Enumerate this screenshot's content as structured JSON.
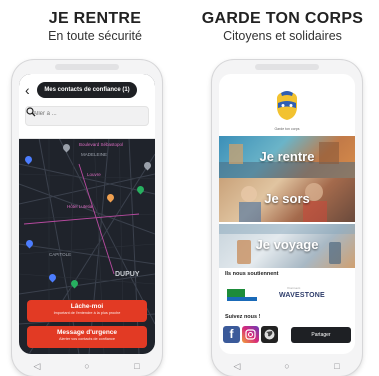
{
  "left_panel": {
    "title": "JE RENTRE",
    "subtitle": "En toute sécurité",
    "header": {
      "contacts_label": "Mes contacts de confiance (1)",
      "search_placeholder": "Aller à ..."
    },
    "map_labels": {
      "a": "Boulevard Sébastopol",
      "b": "MADELEINE",
      "c": "Louvre",
      "d": "Hôtel Lutetia",
      "e": "DUPUY",
      "f": "Capitole"
    },
    "buttons": {
      "lache_title": "Lâche-moi",
      "lache_sub": "Important de l'entendre à la plus proche",
      "urgence_title": "Message d'urgence",
      "urgence_sub": "Alerter vos contacts de confiance"
    },
    "colors": {
      "accent": "#e23a24",
      "map_bg": "#1f232b"
    }
  },
  "right_panel": {
    "title": "GARDE TON CORPS",
    "subtitle": "Citoyens et solidaires",
    "logo_caption": "Garde ton corps",
    "tiles": [
      "Je rentre",
      "Je sors",
      "Je voyage"
    ],
    "supporters_title": "Ils nous soutiennent",
    "sponsors": [
      "Région",
      "WAVESTONE"
    ],
    "sponsor_2_sub": "Vraiment",
    "follow_title": "Suivez nous !",
    "socials": [
      "facebook-icon",
      "instagram-icon",
      "globe-icon"
    ],
    "share_label": "Partager"
  },
  "nav_buttons": [
    "◁",
    "○",
    "□"
  ]
}
